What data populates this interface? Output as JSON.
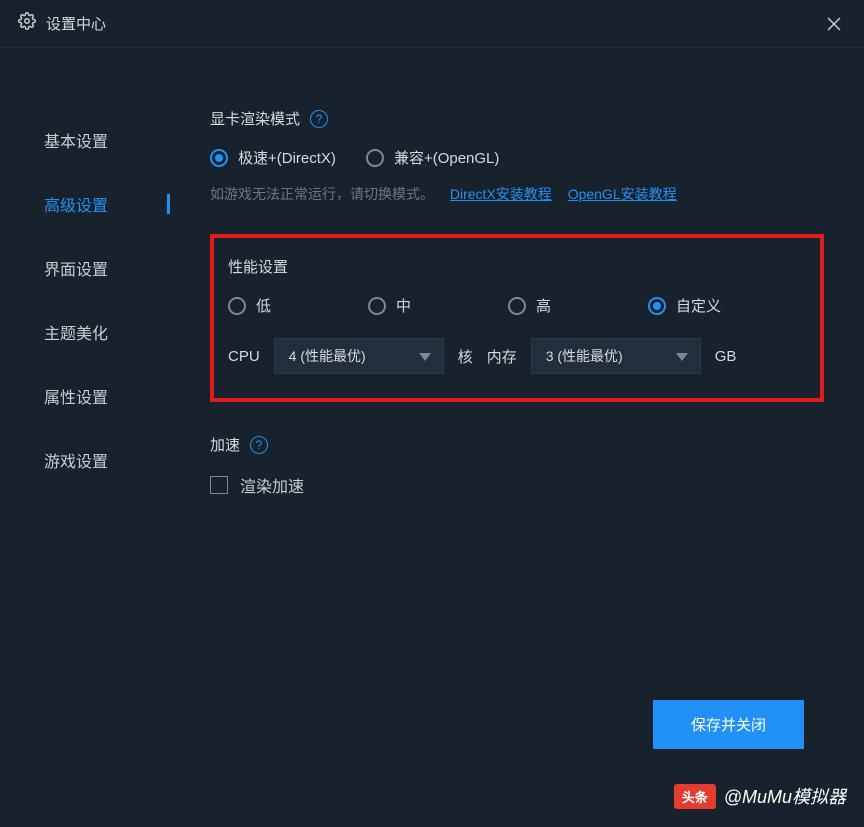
{
  "titlebar": {
    "title": "设置中心"
  },
  "sidebar": {
    "items": [
      {
        "label": "基本设置",
        "active": false
      },
      {
        "label": "高级设置",
        "active": true
      },
      {
        "label": "界面设置",
        "active": false
      },
      {
        "label": "主题美化",
        "active": false
      },
      {
        "label": "属性设置",
        "active": false
      },
      {
        "label": "游戏设置",
        "active": false
      }
    ]
  },
  "render": {
    "title": "显卡渲染模式",
    "options": [
      {
        "label": "极速+(DirectX)",
        "selected": true
      },
      {
        "label": "兼容+(OpenGL)",
        "selected": false
      }
    ],
    "hint": "如游戏无法正常运行，请切换模式。",
    "link1": "DirectX安装教程",
    "link2": "OpenGL安装教程"
  },
  "perf": {
    "title": "性能设置",
    "options": [
      {
        "label": "低",
        "selected": false
      },
      {
        "label": "中",
        "selected": false
      },
      {
        "label": "高",
        "selected": false
      },
      {
        "label": "自定义",
        "selected": true
      }
    ],
    "cpu_label": "CPU",
    "cpu_value": "4 (性能最优)",
    "cpu_unit": "核",
    "mem_label": "内存",
    "mem_value": "3 (性能最优)",
    "mem_unit": "GB"
  },
  "accel": {
    "title": "加速",
    "checkbox_label": "渲染加速"
  },
  "footer": {
    "save": "保存并关闭"
  },
  "watermark": {
    "badge": "头条",
    "text": "@MuMu模拟器"
  }
}
